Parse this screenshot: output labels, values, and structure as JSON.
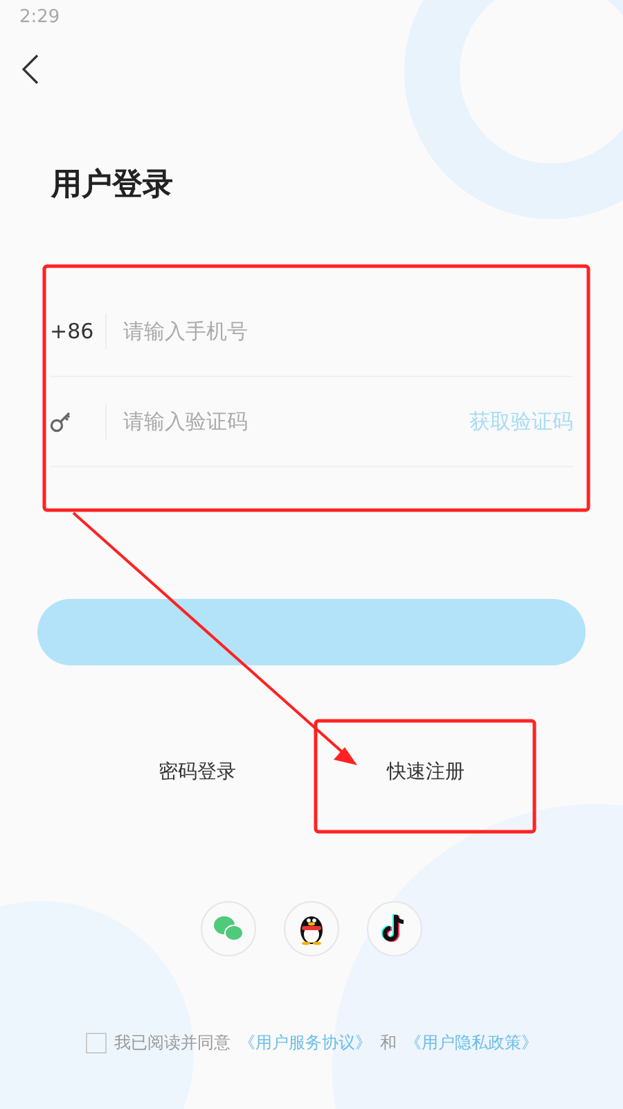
{
  "status_bar": {
    "time": "2:29"
  },
  "title": "用户登录",
  "phone_field": {
    "prefix": "+86",
    "placeholder": "请输入手机号"
  },
  "code_field": {
    "placeholder": "请输入验证码",
    "action": "获取验证码"
  },
  "links": [
    {
      "label": "密码登录"
    },
    {
      "label": "快速注册"
    }
  ],
  "social_logins": [
    {
      "kind": "chat"
    },
    {
      "kind": "penguin"
    },
    {
      "kind": "note"
    }
  ],
  "agreement": {
    "checked": false,
    "text": "我已阅读并同意",
    "link_1": "《用户服务协议》",
    "joiner": "和",
    "link_2": "《用户隐私政策》"
  }
}
